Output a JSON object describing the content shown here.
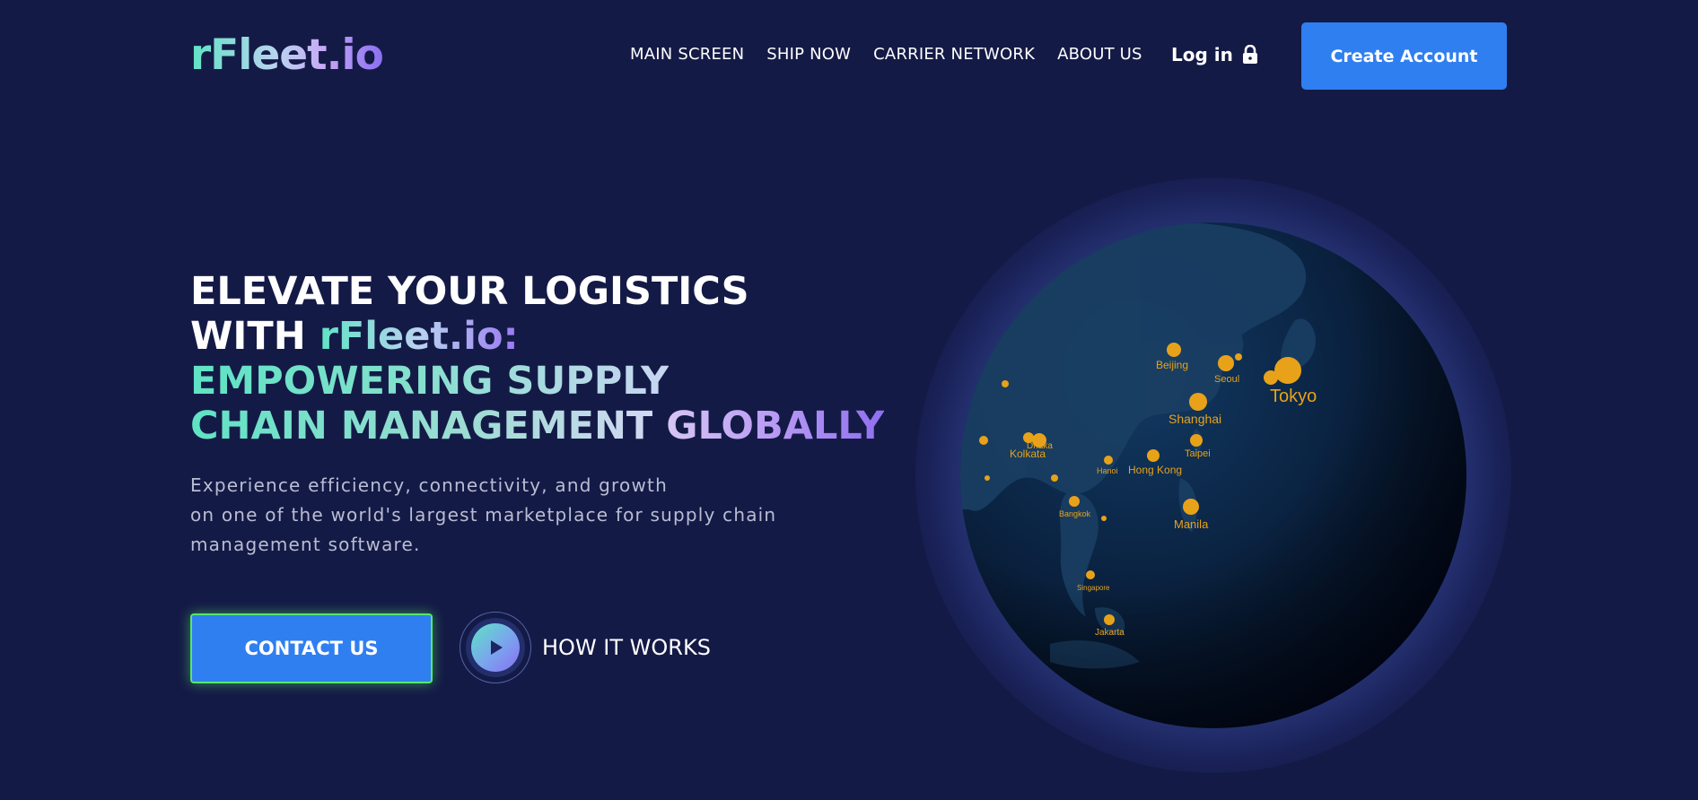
{
  "header": {
    "logo_text": "rFleet.io",
    "nav": [
      {
        "label": "MAIN SCREEN"
      },
      {
        "label": "SHIP NOW"
      },
      {
        "label": "CARRIER NETWORK"
      },
      {
        "label": "ABOUT US"
      }
    ],
    "login_label": "Log in",
    "login_icon": "lock-icon",
    "create_account_label": "Create Account"
  },
  "hero": {
    "headline_line1": "ELEVATE YOUR LOGISTICS",
    "headline_line2_prefix": "WITH ",
    "headline_line2_brand": "rFleet.io:",
    "headline_line3": "EMPOWERING SUPPLY",
    "headline_line4a": "CHAIN MANAGEMENT ",
    "headline_line4b": "GLOBALLY",
    "subtext_line1": "Experience efficiency, connectivity, and growth",
    "subtext_line2": "on one of the world's largest marketplace for supply chain",
    "subtext_line3": "management software.",
    "contact_label": "CONTACT US",
    "how_it_works_label": "HOW IT WORKS",
    "play_icon": "play-icon"
  },
  "globe": {
    "city_labels": [
      "Beijing",
      "Seoul",
      "Tokyo",
      "Shanghai",
      "Taipei",
      "Hong Kong",
      "Manila",
      "Kolkata",
      "Dhaka",
      "Bangkok",
      "Hanoi",
      "Jakarta",
      "Singapore"
    ]
  },
  "colors": {
    "background": "#141a46",
    "primary_button": "#2f7ff0",
    "contact_border": "#55e86a",
    "brand_gradient_start": "#5fe3c4",
    "brand_gradient_end": "#8a6ff2",
    "city_light": "#e8a21a"
  }
}
